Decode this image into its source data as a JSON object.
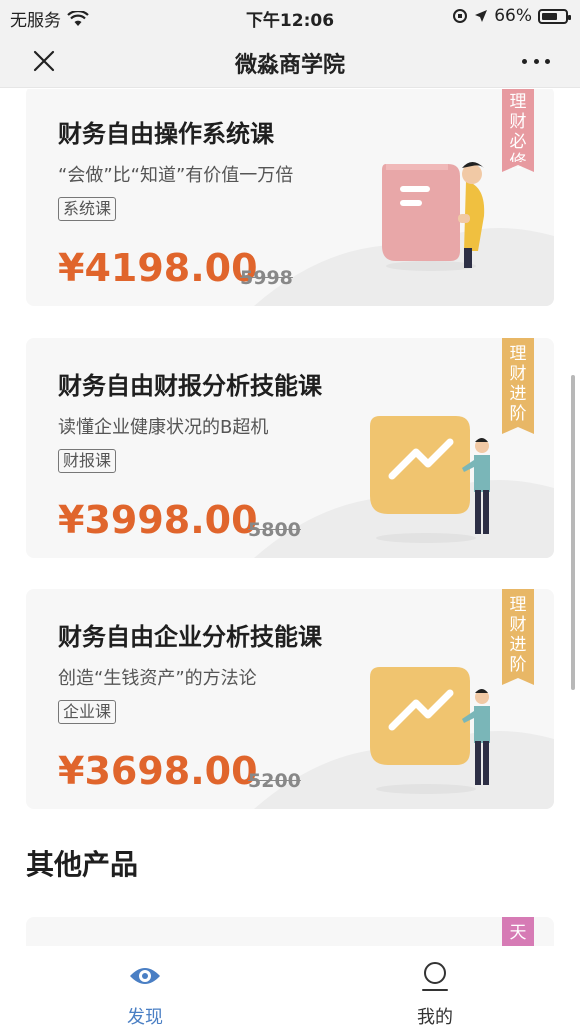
{
  "status_bar": {
    "carrier": "无服务",
    "time": "下午12:06",
    "battery": "66%",
    "battery_level": 0.66
  },
  "nav": {
    "title": "微淼商学院",
    "close_icon": "close-icon",
    "more_icon": "more-icon"
  },
  "courses": [
    {
      "name": "财务自由操作系统课",
      "desc": "“会做”比“知道”有价值一万倍",
      "tag": "系统课",
      "price": "¥4198.00",
      "original_price": "5998",
      "ribbon": "理财必修",
      "ribbon_color": "#e79aa0",
      "illustration": "document-person-illustration"
    },
    {
      "name": "财务自由财报分析技能课",
      "desc": "读懂企业健康状况的B超机",
      "tag": "财报课",
      "price": "¥3998.00",
      "original_price": "5800",
      "ribbon": "理财进阶",
      "ribbon_color": "#e8b766",
      "illustration": "chart-person-illustration"
    },
    {
      "name": "财务自由企业分析技能课",
      "desc": "创造“生钱资产”的方法论",
      "tag": "企业课",
      "price": "¥3698.00",
      "original_price": "5200",
      "ribbon": "理财进阶",
      "ribbon_color": "#e8b766",
      "illustration": "chart-person-illustration"
    }
  ],
  "other_section": {
    "title": "其他产品",
    "peek_ribbon": "天",
    "peek_ribbon_color": "#d67bb5"
  },
  "tabs": [
    {
      "label": "发现",
      "icon": "eye-icon",
      "active": true,
      "color": "#4a7fc4"
    },
    {
      "label": "我的",
      "icon": "user-icon",
      "active": false,
      "color": "#333333"
    }
  ]
}
